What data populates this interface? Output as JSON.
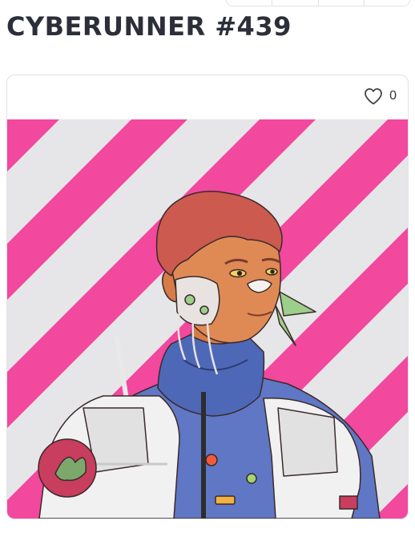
{
  "page": {
    "title": "CYBERUNNER #439"
  },
  "card": {
    "like_icon": "heart-outline-icon",
    "like_count": "0",
    "artwork": {
      "subject": "cyberpunk-portrait",
      "colors": {
        "stripe_pink": "#f2489e",
        "stripe_gray": "#e6e6e8",
        "skin": "#df8a55",
        "hair": "#cc5a4e",
        "suit_blue": "#5f77c4",
        "armor_white": "#f1f1f1",
        "outline": "#3a2a2a"
      }
    }
  },
  "colors": {
    "title_text": "#2c2f3a",
    "border": "#e3e3e7",
    "background": "#ffffff"
  }
}
